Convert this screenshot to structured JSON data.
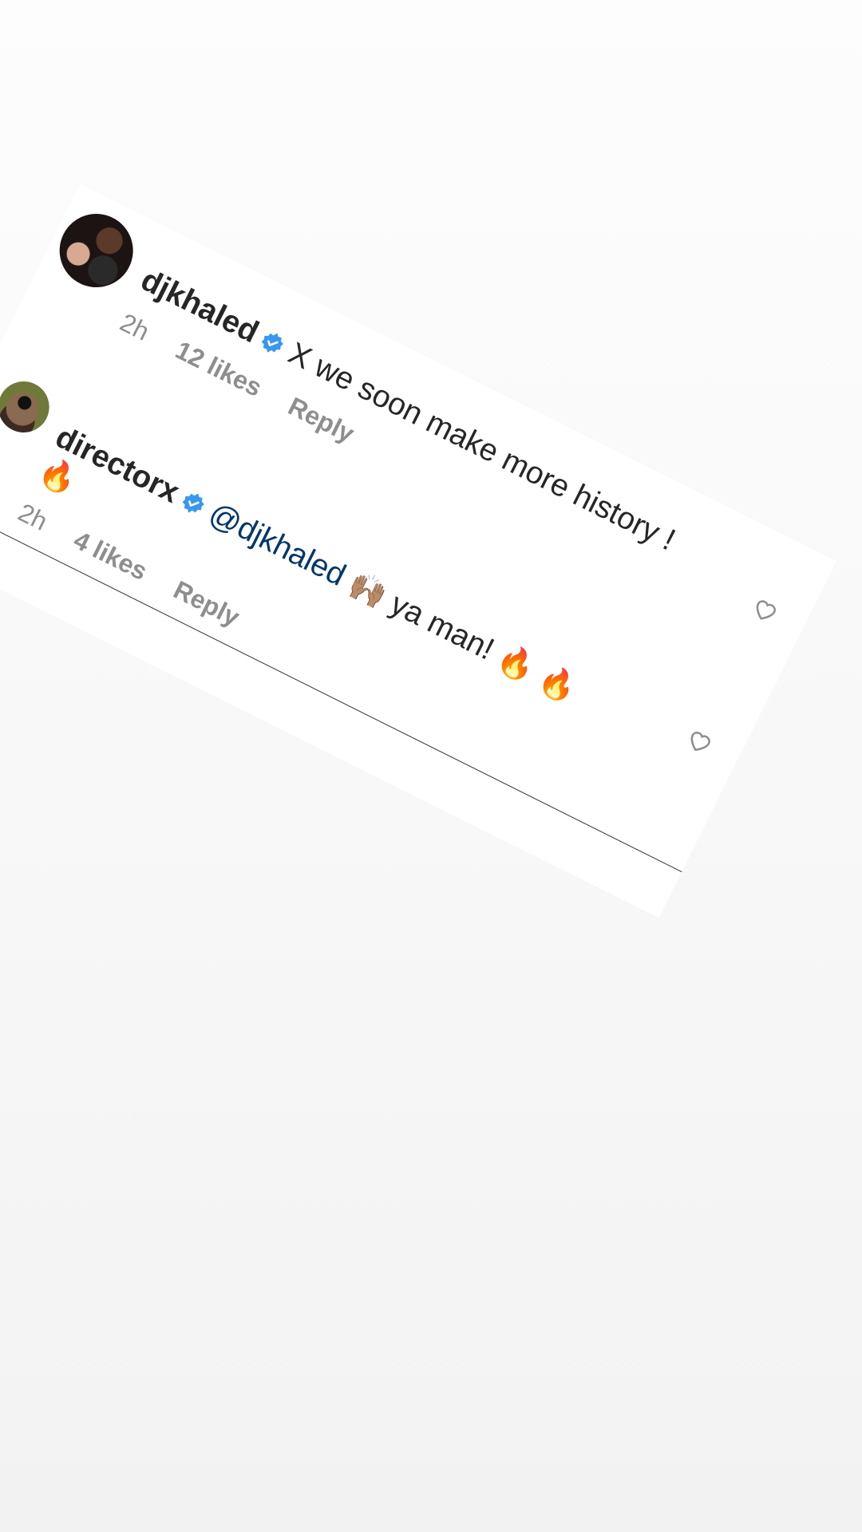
{
  "comments": [
    {
      "username": "djkhaled",
      "verified": true,
      "text": "X we soon make more history !",
      "time": "2h",
      "likes": "12 likes",
      "reply_label": "Reply"
    },
    {
      "username": "directorx",
      "verified": true,
      "mention": "@djkhaled",
      "emoji_1": "🙌🏽",
      "text": " ya man! ",
      "emoji_2": "🔥 🔥",
      "emoji_3": "🔥",
      "time": "2h",
      "likes": "4 likes",
      "reply_label": "Reply"
    }
  ],
  "colors": {
    "verified_blue": "#3897f0",
    "mention": "#00376b",
    "meta_gray": "#8e8e8e"
  },
  "icons": {
    "verified": "verified-badge-icon",
    "like": "heart-outline-icon"
  }
}
